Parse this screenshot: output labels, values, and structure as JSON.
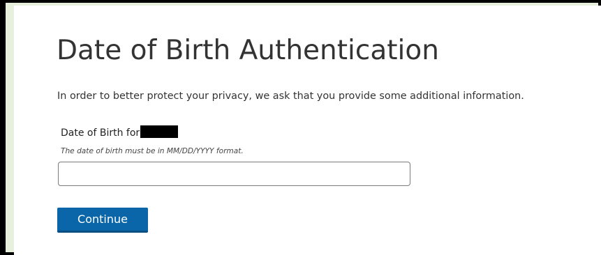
{
  "page": {
    "title": "Date of Birth Authentication",
    "intro": "In order to better protect your privacy, we ask that you provide some additional information."
  },
  "form": {
    "dob_label": "Date of Birth for",
    "dob_hint": "The date of birth must be in MM/DD/YYYY format.",
    "dob_value": "",
    "dob_placeholder": "",
    "continue_label": "Continue"
  },
  "colors": {
    "button_bg": "#0a66a8",
    "frame_border": "#000000",
    "panel_bg": "#ffffff",
    "outer_bg": "#e6f0dc"
  }
}
